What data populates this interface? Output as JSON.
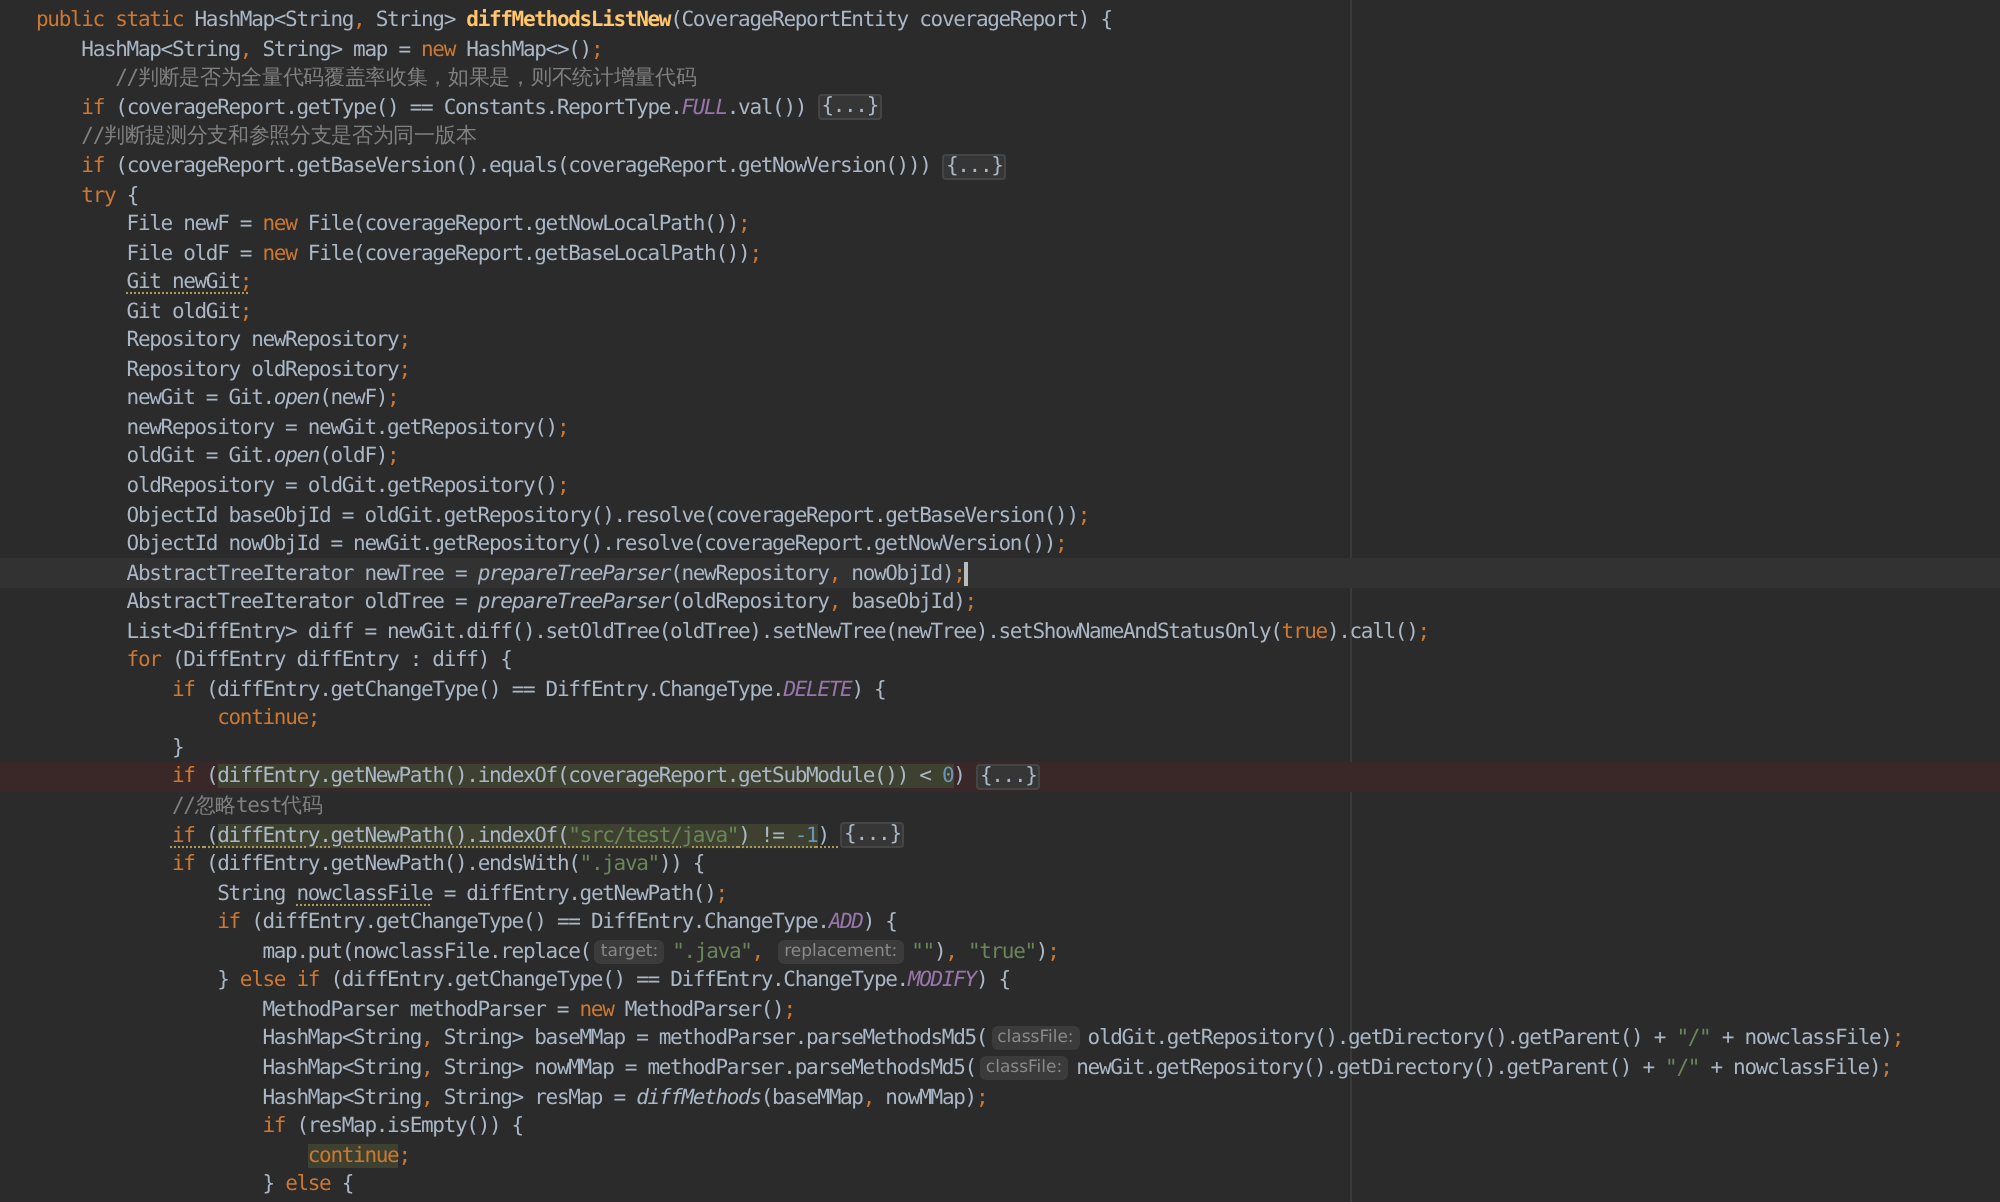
{
  "editor": {
    "lines": [
      {
        "kind": "plain",
        "tokens": [
          {
            "kind": "keyword",
            "text": "public static "
          },
          {
            "kind": "plain",
            "text": "HashMap<String"
          },
          {
            "kind": "punct",
            "text": ", "
          },
          {
            "kind": "plain",
            "text": "String> "
          },
          {
            "kind": "method",
            "text": "diffMethodsListNew"
          },
          {
            "kind": "plain",
            "text": "(CoverageReportEntity coverageReport) {"
          }
        ]
      },
      {
        "kind": "plain",
        "tokens": [
          {
            "kind": "plain",
            "text": "    HashMap<String"
          },
          {
            "kind": "punct",
            "text": ", "
          },
          {
            "kind": "plain",
            "text": "String> map = "
          },
          {
            "kind": "keyword",
            "text": "new "
          },
          {
            "kind": "plain",
            "text": "HashMap<>()"
          },
          {
            "kind": "punct",
            "text": ";"
          }
        ]
      },
      {
        "kind": "plain",
        "tokens": [
          {
            "kind": "comment",
            "text": "       //判断是否为全量代码覆盖率收集，如果是，则不统计增量代码"
          }
        ]
      },
      {
        "kind": "plain",
        "tokens": [
          {
            "kind": "keyword",
            "text": "    if "
          },
          {
            "kind": "plain",
            "text": "(coverageReport.getType() == Constants.ReportType."
          },
          {
            "kind": "constant",
            "text": "FULL"
          },
          {
            "kind": "plain",
            "text": ".val()) "
          },
          {
            "kind": "fold",
            "text": "{...}"
          }
        ]
      },
      {
        "kind": "plain",
        "tokens": [
          {
            "kind": "comment",
            "text": "    //判断提测分支和参照分支是否为同一版本"
          }
        ]
      },
      {
        "kind": "plain",
        "tokens": [
          {
            "kind": "keyword",
            "text": "    if "
          },
          {
            "kind": "plain",
            "text": "(coverageReport.getBaseVersion().equals(coverageReport.getNowVersion())) "
          },
          {
            "kind": "fold",
            "text": "{...}"
          }
        ]
      },
      {
        "kind": "plain",
        "tokens": [
          {
            "kind": "keyword",
            "text": "    try "
          },
          {
            "kind": "plain",
            "text": "{"
          }
        ]
      },
      {
        "kind": "plain",
        "tokens": [
          {
            "kind": "plain",
            "text": "        File newF = "
          },
          {
            "kind": "keyword",
            "text": "new "
          },
          {
            "kind": "plain",
            "text": "File(coverageReport.getNowLocalPath())"
          },
          {
            "kind": "punct",
            "text": ";"
          }
        ]
      },
      {
        "kind": "plain",
        "tokens": [
          {
            "kind": "plain",
            "text": "        File oldF = "
          },
          {
            "kind": "keyword",
            "text": "new "
          },
          {
            "kind": "plain",
            "text": "File(coverageReport.getBaseLocalPath())"
          },
          {
            "kind": "punct",
            "text": ";"
          }
        ]
      },
      {
        "kind": "plain",
        "tokens": [
          {
            "kind": "plain",
            "text": "        Git newGit",
            "underlined": true
          },
          {
            "kind": "punct",
            "text": ";",
            "underlined": true
          }
        ]
      },
      {
        "kind": "plain",
        "tokens": [
          {
            "kind": "plain",
            "text": "        Git oldGit"
          },
          {
            "kind": "punct",
            "text": ";"
          }
        ]
      },
      {
        "kind": "plain",
        "tokens": [
          {
            "kind": "plain",
            "text": "        Repository newRepository"
          },
          {
            "kind": "punct",
            "text": ";"
          }
        ]
      },
      {
        "kind": "plain",
        "tokens": [
          {
            "kind": "plain",
            "text": "        Repository oldRepository"
          },
          {
            "kind": "punct",
            "text": ";"
          }
        ]
      },
      {
        "kind": "plain",
        "tokens": [
          {
            "kind": "plain",
            "text": "        newGit = Git."
          },
          {
            "kind": "static",
            "text": "open"
          },
          {
            "kind": "plain",
            "text": "(newF)"
          },
          {
            "kind": "punct",
            "text": ";"
          }
        ]
      },
      {
        "kind": "plain",
        "tokens": [
          {
            "kind": "plain",
            "text": "        newRepository = newGit.getRepository()"
          },
          {
            "kind": "punct",
            "text": ";"
          }
        ]
      },
      {
        "kind": "plain",
        "tokens": [
          {
            "kind": "plain",
            "text": "        oldGit = Git."
          },
          {
            "kind": "static",
            "text": "open"
          },
          {
            "kind": "plain",
            "text": "(oldF)"
          },
          {
            "kind": "punct",
            "text": ";"
          }
        ]
      },
      {
        "kind": "plain",
        "tokens": [
          {
            "kind": "plain",
            "text": "        oldRepository = oldGit.getRepository()"
          },
          {
            "kind": "punct",
            "text": ";"
          }
        ]
      },
      {
        "kind": "plain",
        "tokens": [
          {
            "kind": "plain",
            "text": "        ObjectId baseObjId = oldGit.getRepository().resolve(coverageReport.getBaseVersion())"
          },
          {
            "kind": "punct",
            "text": ";"
          }
        ]
      },
      {
        "kind": "plain",
        "tokens": [
          {
            "kind": "plain",
            "text": "        ObjectId nowObjId = newGit.getRepository().resolve(coverageReport.getNowVersion())"
          },
          {
            "kind": "punct",
            "text": ";"
          }
        ]
      },
      {
        "kind": "current",
        "tokens": [
          {
            "kind": "plain",
            "text": "        AbstractTreeIterator newTree = "
          },
          {
            "kind": "static",
            "text": "prepareTreeParser"
          },
          {
            "kind": "plain",
            "text": "(newRepository"
          },
          {
            "kind": "punct",
            "text": ", "
          },
          {
            "kind": "plain",
            "text": "nowObjId)"
          },
          {
            "kind": "punct",
            "text": ";"
          }
        ]
      },
      {
        "kind": "plain",
        "tokens": [
          {
            "kind": "plain",
            "text": "        AbstractTreeIterator oldTree = "
          },
          {
            "kind": "static",
            "text": "prepareTreeParser"
          },
          {
            "kind": "plain",
            "text": "(oldRepository"
          },
          {
            "kind": "punct",
            "text": ", "
          },
          {
            "kind": "plain",
            "text": "baseObjId)"
          },
          {
            "kind": "punct",
            "text": ";"
          }
        ]
      },
      {
        "kind": "plain",
        "tokens": [
          {
            "kind": "plain",
            "text": "        List<DiffEntry> diff = newGit.diff().setOldTree(oldTree).setNewTree(newTree).setShowNameAndStatusOnly("
          },
          {
            "kind": "keyword",
            "text": "true"
          },
          {
            "kind": "plain",
            "text": ").call()"
          },
          {
            "kind": "punct",
            "text": ";"
          }
        ]
      },
      {
        "kind": "plain",
        "tokens": [
          {
            "kind": "keyword",
            "text": "        for "
          },
          {
            "kind": "plain",
            "text": "(DiffEntry diffEntry : diff) {"
          }
        ]
      },
      {
        "kind": "plain",
        "tokens": [
          {
            "kind": "keyword",
            "text": "            if "
          },
          {
            "kind": "plain",
            "text": "(diffEntry.getChangeType() == DiffEntry.ChangeType."
          },
          {
            "kind": "constant",
            "text": "DELETE"
          },
          {
            "kind": "plain",
            "text": ") {"
          }
        ]
      },
      {
        "kind": "plain",
        "tokens": [
          {
            "kind": "keyword",
            "text": "                continue"
          },
          {
            "kind": "punct",
            "text": ";"
          }
        ]
      },
      {
        "kind": "plain",
        "tokens": [
          {
            "kind": "plain",
            "text": "            }"
          }
        ]
      },
      {
        "kind": "breakpoint",
        "tokens": [
          {
            "kind": "keyword",
            "text": "            if "
          },
          {
            "kind": "plain",
            "text": "("
          },
          {
            "kind": "plain",
            "text": "diffEntry.getNewPath().indexOf(coverageReport.getSubModule()) < ",
            "highlighted": true
          },
          {
            "kind": "number",
            "text": "0",
            "highlighted": true
          },
          {
            "kind": "plain",
            "text": ") "
          },
          {
            "kind": "fold",
            "text": "{...}"
          }
        ]
      },
      {
        "kind": "plain",
        "tokens": [
          {
            "kind": "comment",
            "text": "            //忽略test代码"
          }
        ]
      },
      {
        "kind": "plain",
        "tokens": [
          {
            "kind": "keyword",
            "text": "            if ",
            "underlined": true
          },
          {
            "kind": "plain",
            "text": "(",
            "underlined": true
          },
          {
            "kind": "plain",
            "text": "diffEntry.getNewPath().indexOf(",
            "highlighted": true,
            "underlined": true
          },
          {
            "kind": "string",
            "text": "\"src/test/java\"",
            "highlighted": true,
            "underlined": true
          },
          {
            "kind": "plain",
            "text": ") != ",
            "highlighted": true,
            "underlined": true
          },
          {
            "kind": "number",
            "text": "-1",
            "highlighted": true,
            "underlined": true
          },
          {
            "kind": "plain",
            "text": ") ",
            "underlined": true
          },
          {
            "kind": "fold",
            "text": "{...}"
          }
        ]
      },
      {
        "kind": "plain",
        "tokens": [
          {
            "kind": "keyword",
            "text": "            if "
          },
          {
            "kind": "plain",
            "text": "(diffEntry.getNewPath().endsWith("
          },
          {
            "kind": "string",
            "text": "\".java\""
          },
          {
            "kind": "plain",
            "text": ")) {"
          }
        ]
      },
      {
        "kind": "plain",
        "tokens": [
          {
            "kind": "plain",
            "text": "                String "
          },
          {
            "kind": "plain",
            "text": "nowclassFile",
            "underlined": true
          },
          {
            "kind": "plain",
            "text": " = diffEntry.getNewPath()"
          },
          {
            "kind": "punct",
            "text": ";"
          }
        ]
      },
      {
        "kind": "plain",
        "tokens": [
          {
            "kind": "keyword",
            "text": "                if "
          },
          {
            "kind": "plain",
            "text": "(diffEntry.getChangeType() == DiffEntry.ChangeType."
          },
          {
            "kind": "constant",
            "text": "ADD"
          },
          {
            "kind": "plain",
            "text": ") {"
          }
        ]
      },
      {
        "kind": "plain",
        "tokens": [
          {
            "kind": "plain",
            "text": "                    map.put(nowclassFile.replace("
          },
          {
            "kind": "hint",
            "text": "target:"
          },
          {
            "kind": "string",
            "text": "\".java\""
          },
          {
            "kind": "punct",
            "text": ", "
          },
          {
            "kind": "hint",
            "text": "replacement:"
          },
          {
            "kind": "string",
            "text": "\"\""
          },
          {
            "kind": "plain",
            "text": ")"
          },
          {
            "kind": "punct",
            "text": ", "
          },
          {
            "kind": "string",
            "text": "\"true\""
          },
          {
            "kind": "plain",
            "text": ")"
          },
          {
            "kind": "punct",
            "text": ";"
          }
        ]
      },
      {
        "kind": "plain",
        "tokens": [
          {
            "kind": "plain",
            "text": "                } "
          },
          {
            "kind": "keyword",
            "text": "else if "
          },
          {
            "kind": "plain",
            "text": "(diffEntry.getChangeType() == DiffEntry.ChangeType."
          },
          {
            "kind": "constant",
            "text": "MODIFY"
          },
          {
            "kind": "plain",
            "text": ") {"
          }
        ]
      },
      {
        "kind": "plain",
        "tokens": [
          {
            "kind": "plain",
            "text": "                    MethodParser methodParser = "
          },
          {
            "kind": "keyword",
            "text": "new "
          },
          {
            "kind": "plain",
            "text": "MethodParser()"
          },
          {
            "kind": "punct",
            "text": ";"
          }
        ]
      },
      {
        "kind": "plain",
        "tokens": [
          {
            "kind": "plain",
            "text": "                    HashMap<String"
          },
          {
            "kind": "punct",
            "text": ", "
          },
          {
            "kind": "plain",
            "text": "String> baseMMap = methodParser.parseMethodsMd5("
          },
          {
            "kind": "hint",
            "text": "classFile:"
          },
          {
            "kind": "plain",
            "text": "oldGit.getRepository().getDirectory().getParent() + "
          },
          {
            "kind": "string",
            "text": "\"/\""
          },
          {
            "kind": "plain",
            "text": " + nowclassFile)"
          },
          {
            "kind": "punct",
            "text": ";"
          }
        ]
      },
      {
        "kind": "plain",
        "tokens": [
          {
            "kind": "plain",
            "text": "                    HashMap<String"
          },
          {
            "kind": "punct",
            "text": ", "
          },
          {
            "kind": "plain",
            "text": "String> nowMMap = methodParser.parseMethodsMd5("
          },
          {
            "kind": "hint",
            "text": "classFile:"
          },
          {
            "kind": "plain",
            "text": "newGit.getRepository().getDirectory().getParent() + "
          },
          {
            "kind": "string",
            "text": "\"/\""
          },
          {
            "kind": "plain",
            "text": " + nowclassFile)"
          },
          {
            "kind": "punct",
            "text": ";"
          }
        ]
      },
      {
        "kind": "plain",
        "tokens": [
          {
            "kind": "plain",
            "text": "                    HashMap<String"
          },
          {
            "kind": "punct",
            "text": ", "
          },
          {
            "kind": "plain",
            "text": "String> resMap = "
          },
          {
            "kind": "static",
            "text": "diffMethods"
          },
          {
            "kind": "plain",
            "text": "(baseMMap"
          },
          {
            "kind": "punct",
            "text": ", "
          },
          {
            "kind": "plain",
            "text": "nowMMap)"
          },
          {
            "kind": "punct",
            "text": ";"
          }
        ]
      },
      {
        "kind": "plain",
        "tokens": [
          {
            "kind": "keyword",
            "text": "                    if "
          },
          {
            "kind": "plain",
            "text": "(resMap.isEmpty()) {"
          }
        ]
      },
      {
        "kind": "plain",
        "tokens": [
          {
            "kind": "keyword",
            "text": "                        continue",
            "highlighted": true
          },
          {
            "kind": "punct",
            "text": ";"
          }
        ]
      },
      {
        "kind": "plain",
        "tokens": [
          {
            "kind": "plain",
            "text": "                    } "
          },
          {
            "kind": "keyword",
            "text": "else "
          },
          {
            "kind": "plain",
            "text": "{"
          }
        ]
      }
    ]
  }
}
